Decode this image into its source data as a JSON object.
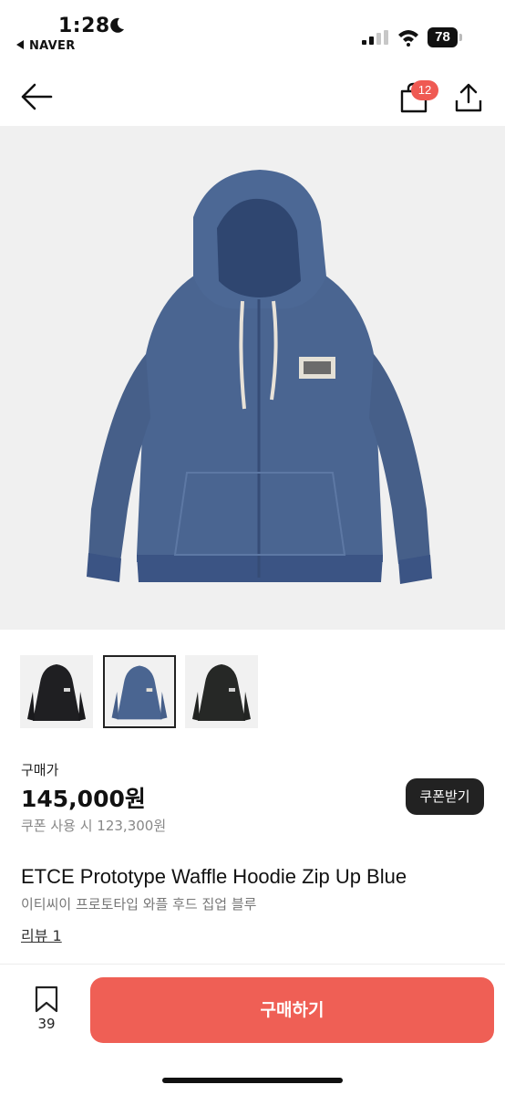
{
  "status_bar": {
    "time": "1:28",
    "back_app": "NAVER",
    "battery": "78"
  },
  "nav": {
    "cart_count": "12",
    "icons": [
      "back-arrow-icon",
      "shopping-bag-icon",
      "share-icon"
    ]
  },
  "gallery": {
    "hero_alt": "blue zip-up hoodie",
    "thumbnails": [
      {
        "color": "#1f1f22",
        "selected": false
      },
      {
        "color": "#4a6591",
        "selected": true
      },
      {
        "color": "#262826",
        "selected": false
      }
    ]
  },
  "price": {
    "label": "구매가",
    "amount": "145,000원",
    "coupon_price": "쿠폰 사용 시 123,300원",
    "coupon_button": "쿠폰받기"
  },
  "product": {
    "title_en": "ETCE Prototype Waffle Hoodie Zip Up Blue",
    "title_ko": "이티씨이 프로토타입 와플 후드 집업 블루",
    "reviews": "리뷰 1"
  },
  "bottom_bar": {
    "bookmark_count": "39",
    "buy_button": "구매하기"
  },
  "colors": {
    "accent": "#ef5f55",
    "badge": "#ef5a53",
    "hoodie_blue": "#4a6591"
  }
}
